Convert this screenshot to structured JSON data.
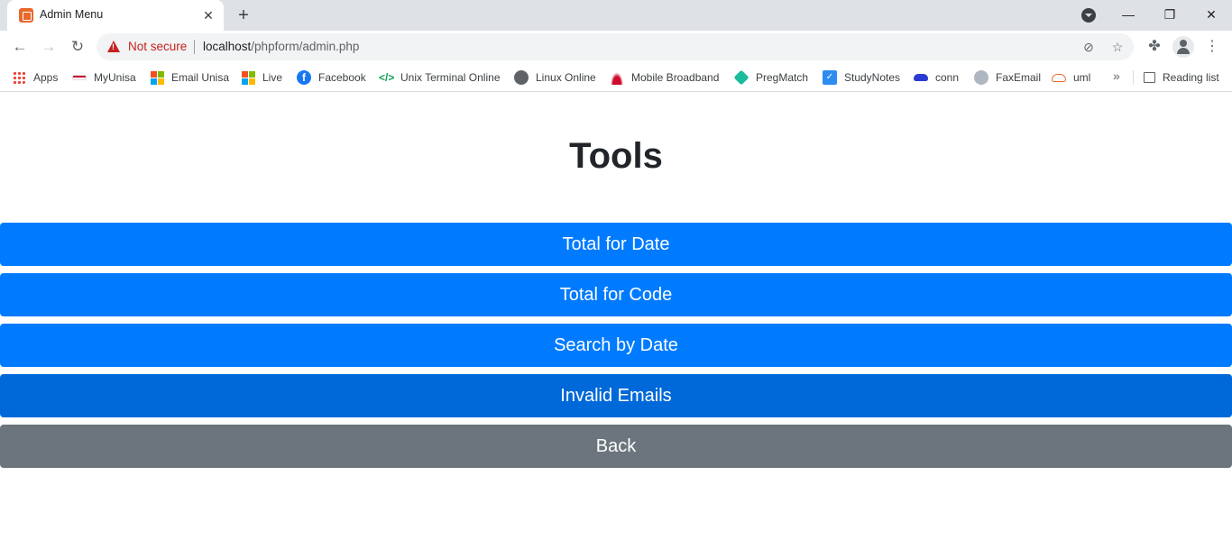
{
  "browser": {
    "tab_title": "Admin Menu",
    "tab_close": "✕",
    "new_tab": "+",
    "window_controls": {
      "minimize": "—",
      "restore": "❐",
      "close": "✕"
    },
    "security_label": "Not secure",
    "url_host": "localhost",
    "url_path": "/phpform/admin.php"
  },
  "bookmarks": {
    "items": [
      {
        "label": "Apps",
        "icon": "apps-grid-icon"
      },
      {
        "label": "MyUnisa",
        "icon": "unisa-flag-icon",
        "color": "#c8102e"
      },
      {
        "label": "Email Unisa",
        "icon": "microsoft-icon"
      },
      {
        "label": "Live",
        "icon": "microsoft-icon"
      },
      {
        "label": "Facebook",
        "icon": "facebook-icon",
        "color": "#1877f2"
      },
      {
        "label": "Unix Terminal Online",
        "icon": "code-icon",
        "color": "#0f9d58"
      },
      {
        "label": "Linux Online",
        "icon": "globe-icon",
        "color": "#5f6368"
      },
      {
        "label": "Mobile Broadband",
        "icon": "huawei-icon",
        "color": "#cf0a2c"
      },
      {
        "label": "PregMatch",
        "icon": "pregmatch-icon",
        "color": "#1abc9c"
      },
      {
        "label": "StudyNotes",
        "icon": "studynotes-icon",
        "color": "#2d8cf0"
      },
      {
        "label": "conn",
        "icon": "cloud-icon",
        "color": "#2b3bd1"
      },
      {
        "label": "FaxEmail",
        "icon": "fax-icon",
        "color": "#7b8794"
      },
      {
        "label": "uml",
        "icon": "cloud-outline-icon",
        "color": "#e8692c"
      }
    ],
    "overflow": "»",
    "reading_list": "Reading list"
  },
  "page": {
    "title": "Tools",
    "buttons": [
      {
        "label": "Total for Date",
        "variant": "primary"
      },
      {
        "label": "Total for Code",
        "variant": "primary"
      },
      {
        "label": "Search by Date",
        "variant": "primary"
      },
      {
        "label": "Invalid Emails",
        "variant": "primary-hover"
      },
      {
        "label": "Back",
        "variant": "secondary"
      }
    ]
  },
  "colors": {
    "primary": "#007bff",
    "primary_hover": "#0069d9",
    "secondary": "#6c757d",
    "warning_red": "#c5221f"
  }
}
